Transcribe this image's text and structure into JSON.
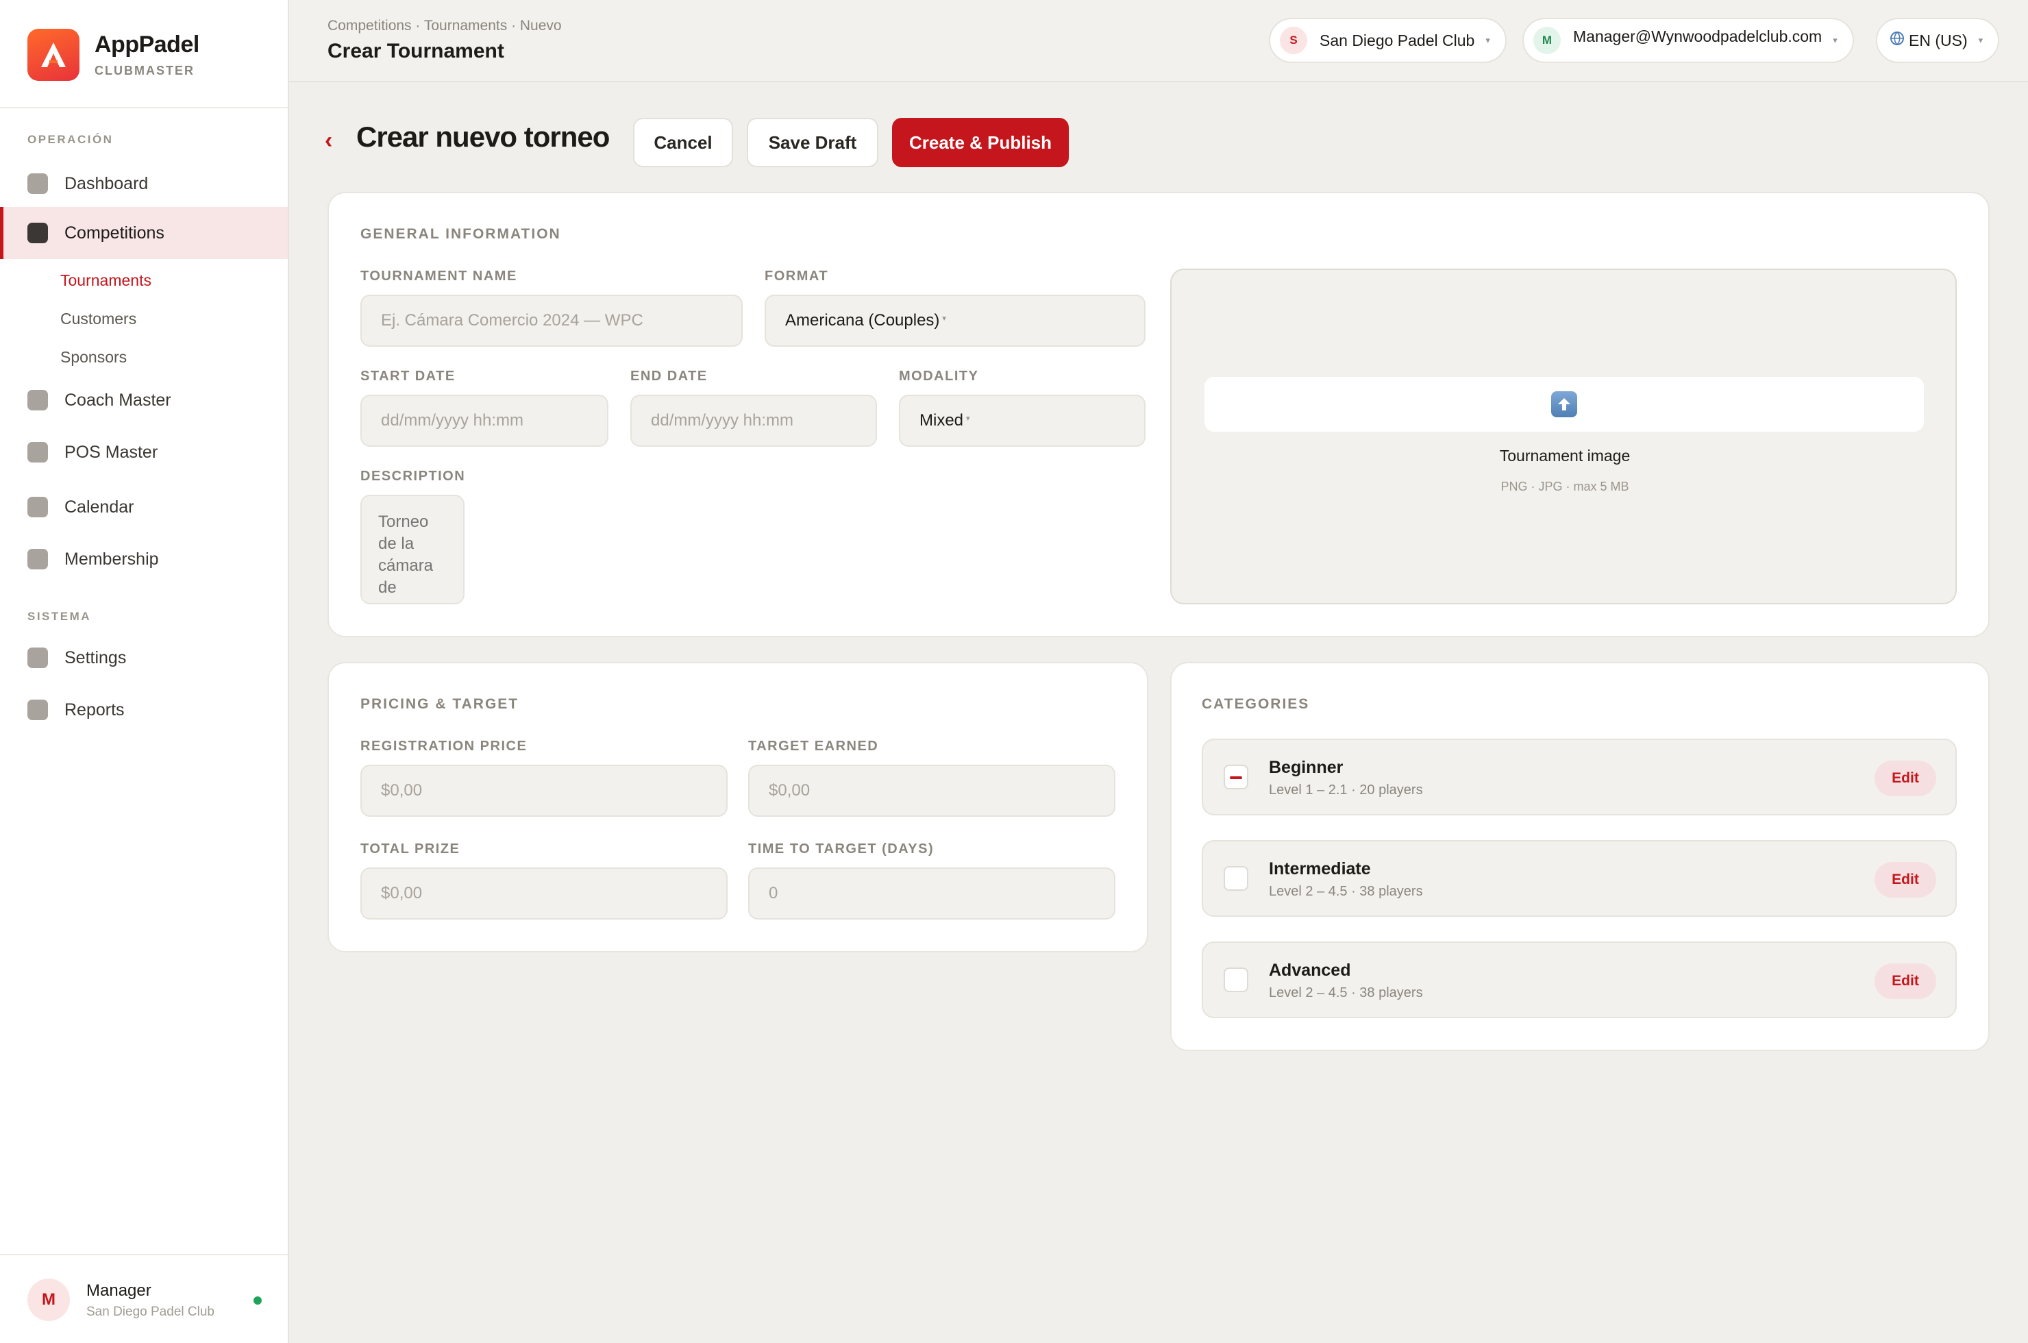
{
  "brand": {
    "name": "AppPadel",
    "subtitle": "CLUBMASTER"
  },
  "sidebar": {
    "section_operacion": "OPERACIÓN",
    "section_sistema": "SISTEMA",
    "items": [
      {
        "label": "Dashboard"
      },
      {
        "label": "Competitions",
        "active": true
      },
      {
        "label": "Coach Master"
      },
      {
        "label": "POS Master"
      },
      {
        "label": "Calendar"
      },
      {
        "label": "Membership"
      },
      {
        "label": "Settings"
      },
      {
        "label": "Reports"
      }
    ],
    "sub_items": [
      {
        "label": "Tournaments",
        "active": true
      },
      {
        "label": "Customers"
      },
      {
        "label": "Sponsors"
      }
    ]
  },
  "user": {
    "initial": "M",
    "name": "Manager",
    "club": "San Diego Padel Club",
    "status_color": "#1fa35a"
  },
  "topbar": {
    "breadcrumb": "Competitions · Tournaments · Nuevo",
    "title": "Crear Tournament",
    "club_badge": "S",
    "club": "San Diego Padel Club",
    "account_badge": "M",
    "account": "Manager@Wynwoodpadelclub.com",
    "language": "EN (US)"
  },
  "page": {
    "title": "Crear nuevo torneo",
    "cancel": "Cancel",
    "save_draft": "Save Draft",
    "publish": "Create & Publish"
  },
  "general": {
    "title": "GENERAL INFORMATION",
    "name_label": "TOURNAMENT NAME",
    "name_placeholder": "Ej. Cámara Comercio 2024 — WPC",
    "format_label": "FORMAT",
    "format_value": "Americana (Couples)",
    "start_label": "START DATE",
    "start_placeholder": "dd/mm/yyyy hh:mm",
    "end_label": "END DATE",
    "end_placeholder": "dd/mm/yyyy hh:mm",
    "modality_label": "MODALITY",
    "modality_value": "Mixed",
    "description_label": "DESCRIPTION",
    "description_placeholder": "Torneo de la cámara de",
    "image_label": "Tournament image",
    "image_hint": "PNG · JPG · max 5 MB"
  },
  "pricing": {
    "title": "PRICING & TARGET",
    "reg_label": "REGISTRATION PRICE",
    "reg_placeholder": "$0,00",
    "target_label": "TARGET EARNED",
    "target_placeholder": "$0,00",
    "prize_label": "TOTAL PRIZE",
    "prize_placeholder": "$0,00",
    "days_label": "TIME TO TARGET (DAYS)",
    "days_placeholder": "0"
  },
  "categories": {
    "title": "CATEGORIES",
    "edit_label": "Edit",
    "items": [
      {
        "name": "Beginner",
        "meta": "Level 1 – 2.1 · 20 players",
        "checked": true
      },
      {
        "name": "Intermediate",
        "meta": "Level 2 – 4.5 · 38 players",
        "checked": false
      },
      {
        "name": "Advanced",
        "meta": "Level 2 – 4.5 · 38 players",
        "checked": false
      }
    ]
  },
  "colors": {
    "accent": "#c4161c",
    "background": "#f1efeb",
    "card": "#ffffff",
    "brand_gradient": [
      "#ff6a2a",
      "#e8333a"
    ]
  }
}
